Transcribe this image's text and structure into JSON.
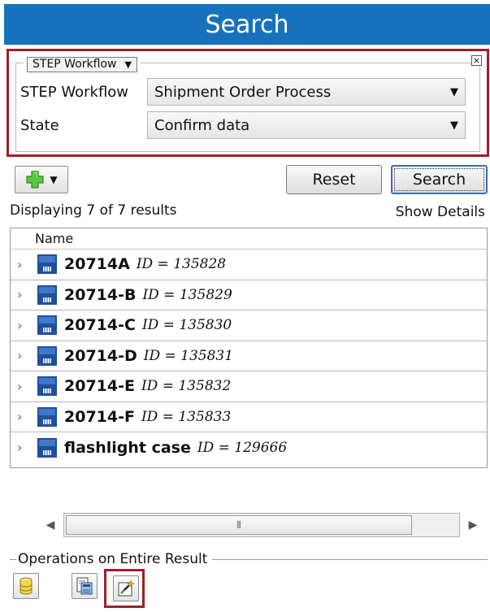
{
  "panel": {
    "title": "Search"
  },
  "criteria_group": {
    "type_label": "STEP Workflow",
    "close_glyph": "×",
    "rows": [
      {
        "label": "STEP Workflow",
        "value": "Shipment Order Process"
      },
      {
        "label": "State",
        "value": "Confirm data"
      }
    ]
  },
  "toolbar": {
    "reset_label": "Reset",
    "search_label": "Search"
  },
  "results": {
    "summary": "Displaying 7 of 7 results",
    "show_details_label": "Show Details",
    "column_header": "Name",
    "items": [
      {
        "name": "20714A",
        "id": "ID = 135828"
      },
      {
        "name": "20714-B",
        "id": "ID = 135829"
      },
      {
        "name": "20714-C",
        "id": "ID = 135830"
      },
      {
        "name": "20714-D",
        "id": "ID = 135831"
      },
      {
        "name": "20714-E",
        "id": "ID = 135832"
      },
      {
        "name": "20714-F",
        "id": "ID = 135833"
      },
      {
        "name": "flashlight case",
        "id": "ID = 129666"
      }
    ]
  },
  "operations": {
    "title": "Operations on Entire Result",
    "buttons": [
      {
        "icon": "database-icon"
      },
      {
        "icon": "export-icon"
      },
      {
        "icon": "wizard-icon"
      }
    ]
  },
  "colors": {
    "title_bar": "#1672bd",
    "highlight": "#a01e2a",
    "item_icon": "#1f4f9c"
  }
}
